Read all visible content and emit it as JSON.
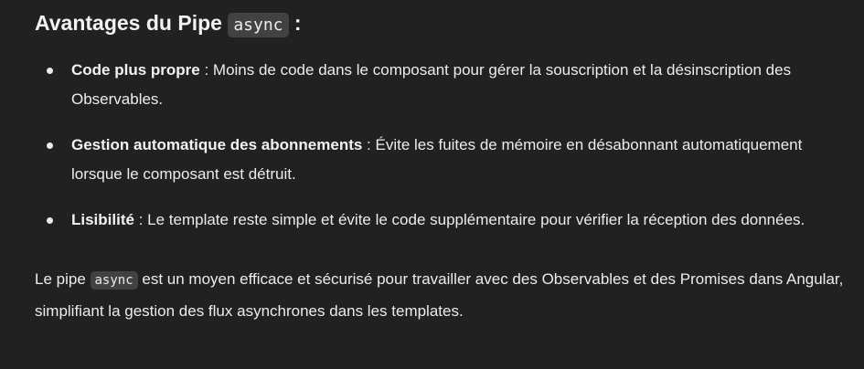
{
  "heading": {
    "prefix": "Avantages du Pipe ",
    "code": "async",
    "suffix": " :"
  },
  "bullets": [
    {
      "term": "Code plus propre",
      "text": " : Moins de code dans le composant pour gérer la souscription et la désinscription des Observables."
    },
    {
      "term": "Gestion automatique des abonnements",
      "text": " : Évite les fuites de mémoire en désabonnant automatiquement lorsque le composant est détruit."
    },
    {
      "term": "Lisibilité",
      "text": " : Le template reste simple et évite le code supplémentaire pour vérifier la réception des données."
    }
  ],
  "paragraph": {
    "prefix": "Le pipe ",
    "code": "async",
    "suffix": " est un moyen efficace et sécurisé pour travailler avec des Observables et des Promises dans Angular, simplifiant la gestion des flux asynchrones dans les templates."
  }
}
